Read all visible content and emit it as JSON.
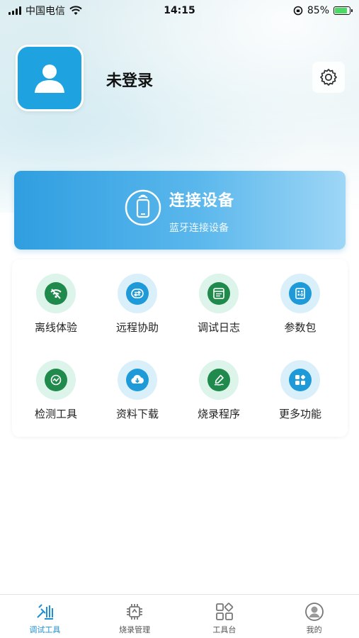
{
  "status_bar": {
    "carrier": "中国电信",
    "time": "14:15",
    "battery": "85%"
  },
  "profile": {
    "name": "未登录"
  },
  "connect": {
    "title": "连接设备",
    "subtitle": "蓝牙连接设备"
  },
  "grid": {
    "items": [
      {
        "label": "离线体验",
        "icon": "wifi-off-icon",
        "bg": "#dcf4ea",
        "fg": "#1f8a4c"
      },
      {
        "label": "远程协助",
        "icon": "swap-arrows-icon",
        "bg": "#d9f0fb",
        "fg": "#1f9ad8"
      },
      {
        "label": "调试日志",
        "icon": "log-document-icon",
        "bg": "#dcf4ea",
        "fg": "#1f8a4c"
      },
      {
        "label": "参数包",
        "icon": "parameter-package-icon",
        "bg": "#d9f0fb",
        "fg": "#1f9ad8"
      },
      {
        "label": "检测工具",
        "icon": "detection-chart-icon",
        "bg": "#dcf4ea",
        "fg": "#1f8a4c"
      },
      {
        "label": "资料下载",
        "icon": "cloud-download-icon",
        "bg": "#d9f0fb",
        "fg": "#1f9ad8"
      },
      {
        "label": "烧录程序",
        "icon": "pen-signature-icon",
        "bg": "#dcf4ea",
        "fg": "#1f8a4c"
      },
      {
        "label": "更多功能",
        "icon": "apps-grid-icon",
        "bg": "#d9f0fb",
        "fg": "#1f9ad8"
      }
    ]
  },
  "tab_bar": {
    "tabs": [
      {
        "label": "调试工具",
        "icon": "debug-tools-icon",
        "active": true
      },
      {
        "label": "烧录管理",
        "icon": "chip-icon",
        "active": false
      },
      {
        "label": "工具台",
        "icon": "workbench-grid-icon",
        "active": false
      },
      {
        "label": "我的",
        "icon": "user-profile-icon",
        "active": false
      }
    ]
  },
  "colors": {
    "accent": "#1e8fd6",
    "avatar_bg": "#1ea3e0",
    "connect_gradient_start": "#2f9ee0",
    "connect_gradient_end": "#9ed6f6"
  }
}
